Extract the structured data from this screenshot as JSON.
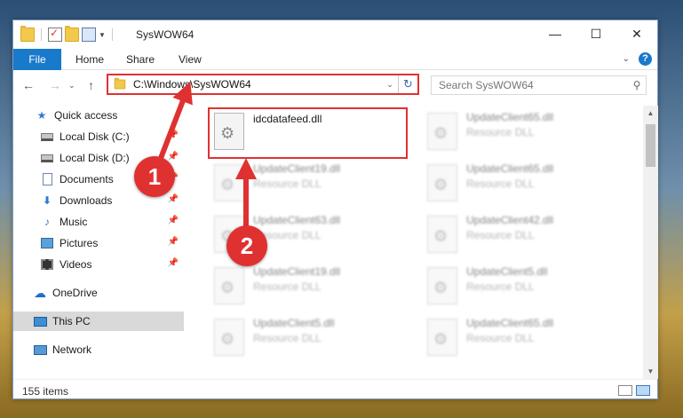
{
  "window": {
    "title": "SysWOW64",
    "controls": {
      "minimize": "—",
      "maximize": "☐",
      "close": "✕"
    }
  },
  "ribbon": {
    "tabs": [
      "File",
      "Home",
      "Share",
      "View"
    ],
    "help": "?"
  },
  "navigation": {
    "address": "C:\\Windows\\SysWOW64",
    "search_placeholder": "Search SysWOW64"
  },
  "sidebar": {
    "items": [
      {
        "label": "Quick access",
        "icon": "star-icon"
      },
      {
        "label": "Local Disk (C:)",
        "icon": "disk-icon"
      },
      {
        "label": "Local Disk (D:)",
        "icon": "disk-icon"
      },
      {
        "label": "Documents",
        "icon": "documents-icon"
      },
      {
        "label": "Downloads",
        "icon": "downloads-icon"
      },
      {
        "label": "Music",
        "icon": "music-icon"
      },
      {
        "label": "Pictures",
        "icon": "pictures-icon"
      },
      {
        "label": "Videos",
        "icon": "videos-icon"
      },
      {
        "label": "OneDrive",
        "icon": "onedrive-icon"
      },
      {
        "label": "This PC",
        "icon": "this-pc-icon"
      },
      {
        "label": "Network",
        "icon": "network-icon"
      }
    ]
  },
  "files": {
    "highlighted": {
      "name": "idcdatafeed.dll"
    },
    "tiles": [
      {
        "name": "UpdateClient65.dll",
        "type": "Resource DLL"
      },
      {
        "name": "UpdateClient19.dll",
        "type": "Resource DLL"
      },
      {
        "name": "UpdateClient65.dll",
        "type": "Resource DLL"
      },
      {
        "name": "UpdateClient63.dll",
        "type": "Resource DLL"
      },
      {
        "name": "UpdateClient42.dll",
        "type": "Resource DLL"
      },
      {
        "name": "UpdateClient19.dll",
        "type": "Resource DLL"
      },
      {
        "name": "UpdateClient5.dll",
        "type": "Resource DLL"
      },
      {
        "name": "UpdateClient5.dll",
        "type": "Resource DLL"
      },
      {
        "name": "UpdateClient65.dll",
        "type": "Resource DLL"
      }
    ]
  },
  "status": {
    "count": "155 items"
  },
  "annotations": {
    "step1": "1",
    "step2": "2",
    "color": "#e03131"
  }
}
